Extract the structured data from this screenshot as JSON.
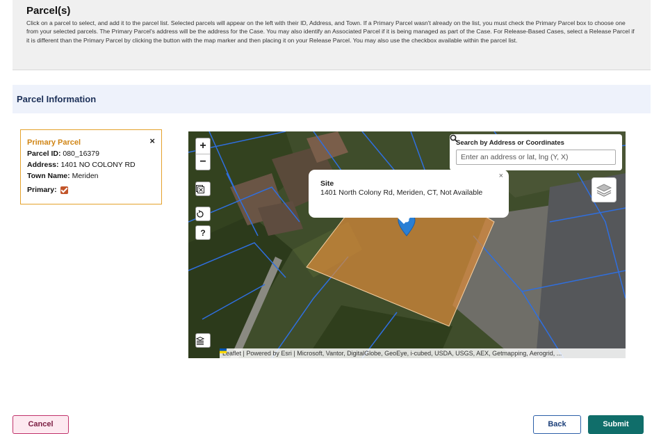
{
  "intro": {
    "title": "Parcel(s)",
    "text": "Click on a parcel to select, and add it to the parcel list. Selected parcels will appear on the left with their ID, Address, and Town. If a Primary Parcel wasn't already on the list, you must check the Primary Parcel box to choose one from your selected parcels. The Primary Parcel's address will be the address for the Case. You may also identify an Associated Parcel if it is being managed as part of the Case. For Release-Based Cases, select a Release Parcel if it is different than the Primary Parcel by clicking the button with the map marker and then placing it on your Release Parcel. You may also use the checkbox available within the parcel list."
  },
  "section": {
    "title": "Parcel Information"
  },
  "parcel": {
    "title": "Primary Parcel",
    "close": "×",
    "id_label": "Parcel ID:",
    "id_value": "080_16379",
    "address_label": "Address:",
    "address_value": "1401 NO COLONY RD",
    "town_label": "Town Name:",
    "town_value": "Meriden",
    "primary_label": "Primary:",
    "primary_checked": true,
    "accent_color": "#e4a12a"
  },
  "map": {
    "zoom_in": "+",
    "zoom_out": "−",
    "help": "?",
    "search": {
      "label": "Search by Address or Coordinates",
      "placeholder": "Enter an address or lat, lng (Y, X)"
    },
    "popup": {
      "title": "Site",
      "body": "1401 North Colony Rd, Meriden, CT, Not Available",
      "close": "×"
    },
    "attribution": "Leaflet | Powered by Esri | Microsoft, Vantor, DigitalGlobe, GeoEye, i-cubed, USDA, USGS, AEX, Getmapping, Aerogrid, ...",
    "parcel_fill": "#d98a3a",
    "parcel_line": "#2f6fe0",
    "marker_color": "#2a7fd4"
  },
  "actions": {
    "cancel": "Cancel",
    "back": "Back",
    "submit": "Submit"
  }
}
